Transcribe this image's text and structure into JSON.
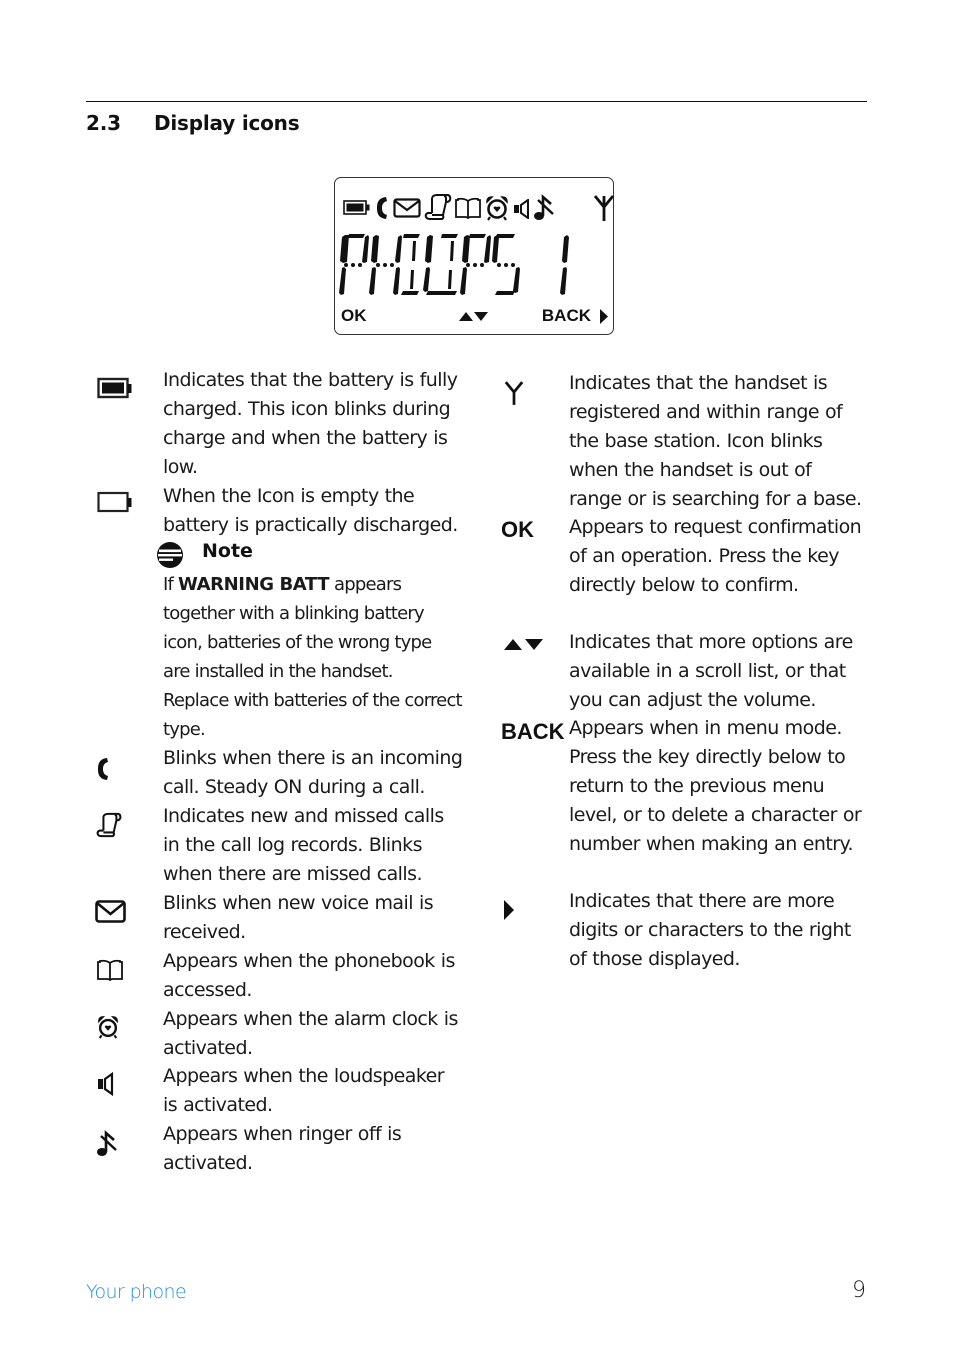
{
  "section": {
    "number": "2.3",
    "title": "Display icons"
  },
  "lcd_display": {
    "status_icons": [
      "battery-full-icon",
      "phone-handset-icon",
      "envelope-icon",
      "call-log-scroll-icon",
      "phonebook-icon",
      "alarm-clock-icon",
      "loudspeaker-icon",
      "ringer-off-icon",
      "antenna-signal-icon"
    ],
    "text": "PHILIPS",
    "number": "1",
    "softkey_left": "OK",
    "softkey_center_icon": "up-down-arrows-icon",
    "softkey_right": "BACK",
    "more_right_icon": "right-arrow-icon"
  },
  "left_entries": [
    {
      "icon": "battery-full-icon",
      "text": "Indicates that the battery is fully charged. This icon blinks during charge and when the battery is low."
    },
    {
      "icon": "battery-empty-icon",
      "text": "When the Icon is empty the battery is practically discharged."
    },
    {
      "icon": "phone-handset-icon",
      "text": "Blinks when there is an incoming call. Steady ON during a call."
    },
    {
      "icon": "call-log-scroll-icon",
      "text": "Indicates new and missed calls in the call log records. Blinks when there are missed calls."
    },
    {
      "icon": "envelope-icon",
      "text": "Blinks when new voice mail is received."
    },
    {
      "icon": "phonebook-icon",
      "text": "Appears when the phonebook is accessed."
    },
    {
      "icon": "alarm-clock-icon",
      "text": "Appears when the alarm clock is activated."
    },
    {
      "icon": "loudspeaker-icon",
      "text": "Appears when the loudspeaker is activated."
    },
    {
      "icon": "ringer-off-icon",
      "text": "Appears when ringer off is activated."
    }
  ],
  "note": {
    "heading": "Note",
    "prefix": "If",
    "emphasis": "WARNING BATT",
    "body": "appears together with a blinking battery icon, batteries of the wrong type are installed in the handset. Replace with batteries of the correct type."
  },
  "right_entries": [
    {
      "icon": "antenna-signal-icon",
      "text": "Indicates that the handset is registered and within range of the base station. Icon blinks when the handset is out of range or is searching for a base."
    },
    {
      "icon_label": "OK",
      "text": "Appears to request confirmation of an operation. Press the key directly below to confirm."
    },
    {
      "icon": "up-down-arrows-icon",
      "text": "Indicates that more options are available in a scroll list, or that you can adjust the volume."
    },
    {
      "icon_label": "BACK",
      "text": "Appears when in menu mode. Press the key directly below to return to the previous menu level, or to delete a character or number when making an entry."
    },
    {
      "icon": "right-arrow-icon",
      "text": "Indicates that there are more digits or characters to the right of those displayed."
    }
  ],
  "footer": {
    "section_name": "Your phone",
    "page_number": "9"
  },
  "colors": {
    "footer_accent": "#2a8fd0",
    "text": "#1a1a1a"
  }
}
